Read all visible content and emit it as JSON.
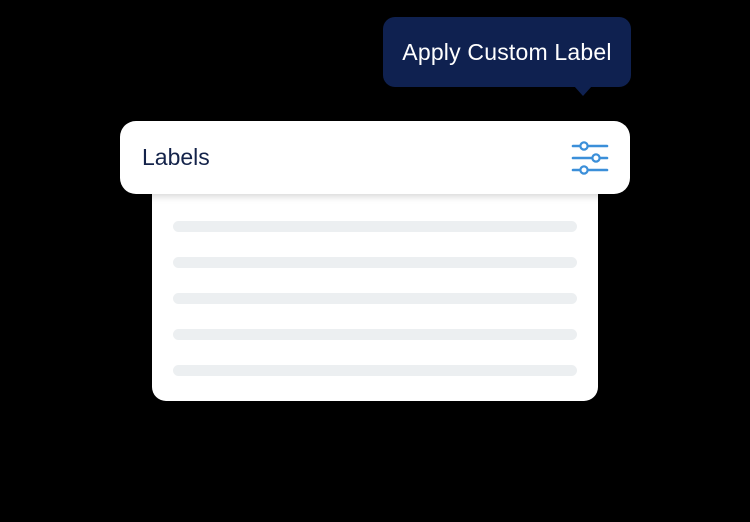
{
  "tooltip": {
    "text": "Apply Custom Label"
  },
  "panel": {
    "title": "Labels",
    "filter_icon": "sliders-icon",
    "skeleton_rows": 5
  },
  "colors": {
    "background": "#000000",
    "tooltip_bg": "#0f2150",
    "title_text": "#14234a",
    "icon_accent": "#3b8fd9",
    "skeleton": "#eceff1"
  }
}
